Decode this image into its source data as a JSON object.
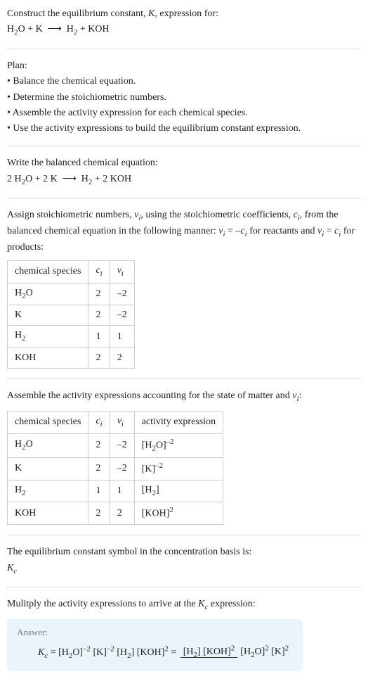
{
  "intro": {
    "line1": "Construct the equilibrium constant, <i>K</i>, expression for:",
    "equation": "H<sub>2</sub>O + K &nbsp;⟶&nbsp; H<sub>2</sub> + KOH"
  },
  "plan": {
    "heading": "Plan:",
    "items": [
      "• Balance the chemical equation.",
      "• Determine the stoichiometric numbers.",
      "• Assemble the activity expression for each chemical species.",
      "• Use the activity expressions to build the equilibrium constant expression."
    ]
  },
  "balanced": {
    "line": "Write the balanced chemical equation:",
    "equation": "2 H<sub>2</sub>O + 2 K &nbsp;⟶&nbsp; H<sub>2</sub> + 2 KOH"
  },
  "assign": {
    "text": "Assign stoichiometric numbers, <i>ν<sub>i</sub></i>, using the stoichiometric coefficients, <i>c<sub>i</sub></i>, from the balanced chemical equation in the following manner: <i>ν<sub>i</sub></i> = –<i>c<sub>i</sub></i> for reactants and <i>ν<sub>i</sub></i> = <i>c<sub>i</sub></i> for products:"
  },
  "table1": {
    "headers": [
      "chemical species",
      "<i>c<sub>i</sub></i>",
      "<i>ν<sub>i</sub></i>"
    ],
    "rows": [
      [
        "H<sub>2</sub>O",
        "2",
        "–2"
      ],
      [
        "K",
        "2",
        "–2"
      ],
      [
        "H<sub>2</sub>",
        "1",
        "1"
      ],
      [
        "KOH",
        "2",
        "2"
      ]
    ]
  },
  "assemble": {
    "text": "Assemble the activity expressions accounting for the state of matter and <i>ν<sub>i</sub></i>:"
  },
  "table2": {
    "headers": [
      "chemical species",
      "<i>c<sub>i</sub></i>",
      "<i>ν<sub>i</sub></i>",
      "activity expression"
    ],
    "rows": [
      [
        "H<sub>2</sub>O",
        "2",
        "–2",
        "[H<sub>2</sub>O]<sup>–2</sup>"
      ],
      [
        "K",
        "2",
        "–2",
        "[K]<sup>–2</sup>"
      ],
      [
        "H<sub>2</sub>",
        "1",
        "1",
        "[H<sub>2</sub>]"
      ],
      [
        "KOH",
        "2",
        "2",
        "[KOH]<sup>2</sup>"
      ]
    ]
  },
  "symbol": {
    "line": "The equilibrium constant symbol in the concentration basis is:",
    "kc": "<i>K<sub>c</sub></i>"
  },
  "multiply": {
    "line": "Mulitply the activity expressions to arrive at the <i>K<sub>c</sub></i> expression:"
  },
  "answer": {
    "label": "Answer:",
    "lhs": "<i>K<sub>c</sub></i> = [H<sub>2</sub>O]<sup>–2</sup> [K]<sup>–2</sup> [H<sub>2</sub>] [KOH]<sup>2</sup> = ",
    "num": "[H<sub>2</sub>] [KOH]<sup>2</sup>",
    "den": "[H<sub>2</sub>O]<sup>2</sup> [K]<sup>2</sup>"
  }
}
